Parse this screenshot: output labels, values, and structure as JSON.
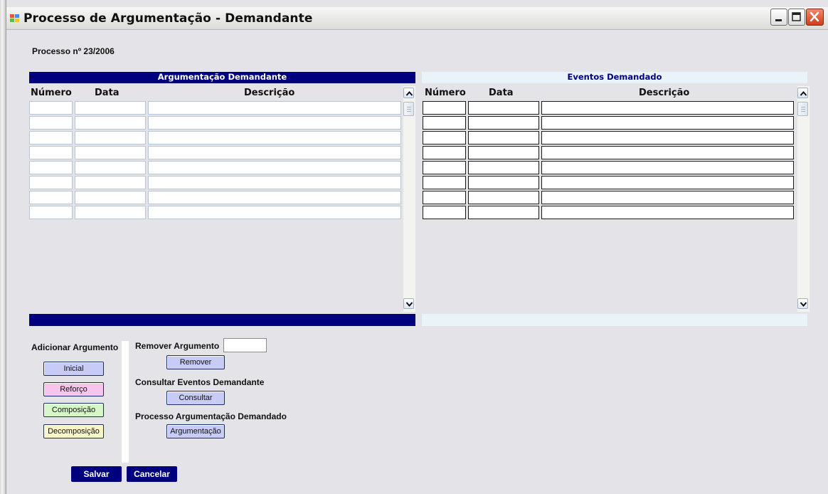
{
  "window": {
    "title": "Processo de Argumentação - Demandante"
  },
  "process_label": "Processo nº 23/2006",
  "left_grid": {
    "title": "Argumentação Demandante",
    "columns": [
      "Número",
      "Data",
      "Descrição"
    ],
    "row_count": 8
  },
  "right_grid": {
    "title": "Eventos Demandado",
    "columns": [
      "Número",
      "Data",
      "Descrição"
    ],
    "row_count": 8
  },
  "add_section": {
    "label": "Adicionar Argumento",
    "buttons": {
      "inicial": "Inicial",
      "reforco": "Reforço",
      "composicao": "Composição",
      "decomposicao": "Decomposição"
    }
  },
  "remove_section": {
    "label": "Remover Argumento",
    "input_value": "",
    "button": "Remover"
  },
  "consult_section": {
    "label": "Consultar Eventos Demandante",
    "button": "Consultar"
  },
  "argumentation_section": {
    "label": "Processo Argumentação Demandado",
    "button": "Argumentação"
  },
  "footer": {
    "save": "Salvar",
    "cancel": "Cancelar"
  },
  "colors": {
    "header_blue": "#00007f",
    "light_header": "#eaf2fa",
    "background": "#e3e3e8",
    "inicial": "#c8cbf6",
    "reforco": "#f7c4ee",
    "composicao": "#d6f7c8",
    "decomposicao": "#f8f6c6"
  }
}
